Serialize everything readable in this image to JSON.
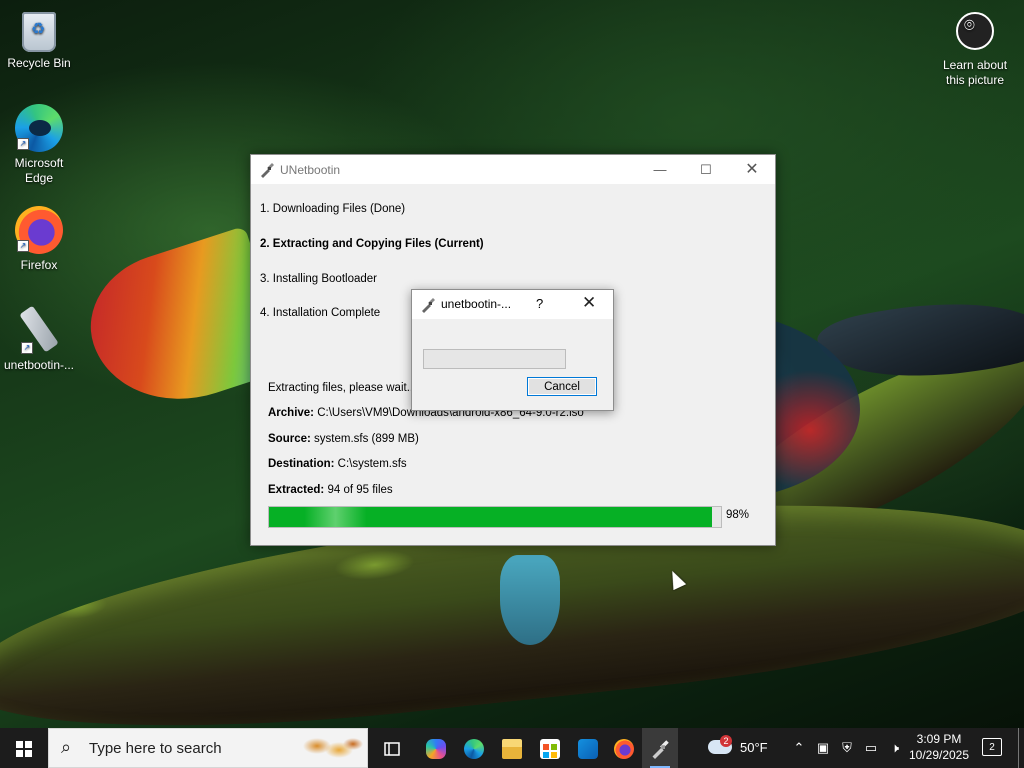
{
  "desktop": {
    "icons": [
      {
        "label": "Recycle Bin",
        "icon": "recycle-bin-icon"
      },
      {
        "label": "Microsoft Edge",
        "icon": "edge-icon"
      },
      {
        "label": "Firefox",
        "icon": "firefox-icon"
      },
      {
        "label": "unetbootin-...",
        "icon": "unetbootin-icon"
      },
      {
        "label": "Learn about this picture",
        "icon": "learn-about-icon"
      }
    ]
  },
  "main_window": {
    "title": "UNetbootin",
    "controls": {
      "minimize": "—",
      "maximize": "☐",
      "close": "✕"
    },
    "steps": [
      {
        "label": "1. Downloading Files (Done)",
        "current": false
      },
      {
        "label": "2. Extracting and Copying Files (Current)",
        "current": true
      },
      {
        "label": "3. Installing Bootloader",
        "current": false
      },
      {
        "label": "4. Installation Complete",
        "current": false
      }
    ],
    "status": "Extracting files, please wait...",
    "archive_label": "Archive:",
    "archive_value": "C:\\Users\\VM9\\Downloads\\android-x86_64-9.0-r2.iso",
    "source_label": "Source:",
    "source_value": "system.sfs (899 MB)",
    "destination_label": "Destination:",
    "destination_value": "C:\\system.sfs",
    "extracted_label": "Extracted:",
    "extracted_value": "94 of 95 files",
    "progress_percent": 98,
    "progress_text": "98%"
  },
  "dialog": {
    "title": "unetbootin-...",
    "help": "?",
    "close": "✕",
    "progress_percent": 0,
    "cancel_label": "Cancel"
  },
  "taskbar": {
    "search_placeholder": "Type here to search",
    "apps": [
      "task-view-icon",
      "copilot-icon",
      "edge-icon",
      "file-explorer-icon",
      "store-icon",
      "outlook-icon",
      "firefox-icon",
      "unetbootin-icon"
    ],
    "weather": {
      "temp": "50°F",
      "badge": "2"
    },
    "time": "3:09 PM",
    "date": "10/29/2025",
    "notifications": "2"
  },
  "colors": {
    "progress_fill": "#06b025",
    "taskbar_bg": "#1c1c1c",
    "accent": "#0078d7"
  }
}
